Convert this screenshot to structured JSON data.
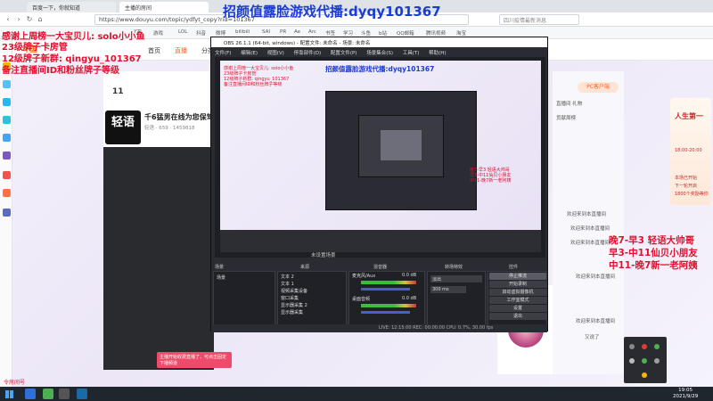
{
  "browser": {
    "tabs": [
      "百度一下，你就知道",
      "主播的房间"
    ],
    "url": "https://www.douyu.com/topic/ydfyt_copy?rid=101367",
    "search_placeholder": "四川疫情最新消息",
    "bookmarks": [
      "YZI",
      "游戏",
      "LOL",
      "抖音",
      "微博",
      "bilibili",
      "SAI",
      "PR",
      "Ae",
      "Arc",
      "书签",
      "学习",
      "斗鱼",
      "b站",
      "QQ邮箱",
      "腾讯视频",
      "淘宝"
    ]
  },
  "overlay": {
    "title": "招颜值露脸游戏代播:dyqy101367",
    "left_lines": [
      "感谢上周榜一大宝贝儿: solo小小鱼",
      "23级牌子卡房管",
      "12级牌子新群: qingyu_101367",
      "备注直播间ID和粉丝牌子等级"
    ],
    "right_lines": [
      "晚7-早3  轻语大帅哥",
      "早3-中11仙贝小朋友",
      "中11-晚7新一老阿姨"
    ]
  },
  "douyu": {
    "logo": "斗鱼",
    "nav": [
      "首页",
      "直播",
      "分类"
    ],
    "level": "11",
    "logo_text": "轻语",
    "room_title": "千6猛男在线为您保驾护航",
    "room_meta": "轻语 · 659 · 1459818",
    "tip": "主播开始收费直播了，可点击固定下播频道",
    "pc_btn": "PC客户端",
    "chat": [
      "直播间 礼物",
      "贡献周榜",
      "欢迎来到本直播间",
      "欢迎来到本直播间",
      "欢迎来到本直播间",
      "欢迎来到本直播间",
      "欢迎来到本直播间",
      "又说了"
    ],
    "promo_title": "人生第一",
    "promo_lines": [
      "18:00-20:00",
      "本场已开始",
      "下一轮开启",
      "1800个奖励等你"
    ],
    "badge": "令房间号"
  },
  "obs": {
    "title": "OBS 26.1.1 (64-bit, windows) - 配置文件: 未命名 - 场景: 未命名",
    "menu": [
      "文件(F)",
      "编辑(E)",
      "视图(V)",
      "停靠部件(D)",
      "配置文件(P)",
      "场景集合(S)",
      "工具(T)",
      "帮助(H)"
    ],
    "scene_bar": "未设置场景",
    "dock_headers": [
      "场景",
      "来源",
      "混音器",
      "转场特效",
      "控件"
    ],
    "scene": "场景",
    "sources": [
      "文本 2",
      "文本 1",
      "视频采集设备",
      "窗口采集",
      "显示器采集 2",
      "显示器采集"
    ],
    "mixer": [
      {
        "name": "麦克风/Aux",
        "level": "0.0 dB"
      },
      {
        "name": "桌面音频",
        "level": "0.0 dB"
      }
    ],
    "transition": "淡出",
    "duration": "300 ms",
    "controls": [
      "停止推流",
      "开始录制",
      "启动虚拟摄像机",
      "工作室模式",
      "设置",
      "退出"
    ],
    "status": "LIVE: 12:15:00   REC: 00:00:00   CPU: 0.7%, 30.00 fps"
  },
  "taskbar": {
    "time": "19:05",
    "date": "2021/9/29"
  }
}
